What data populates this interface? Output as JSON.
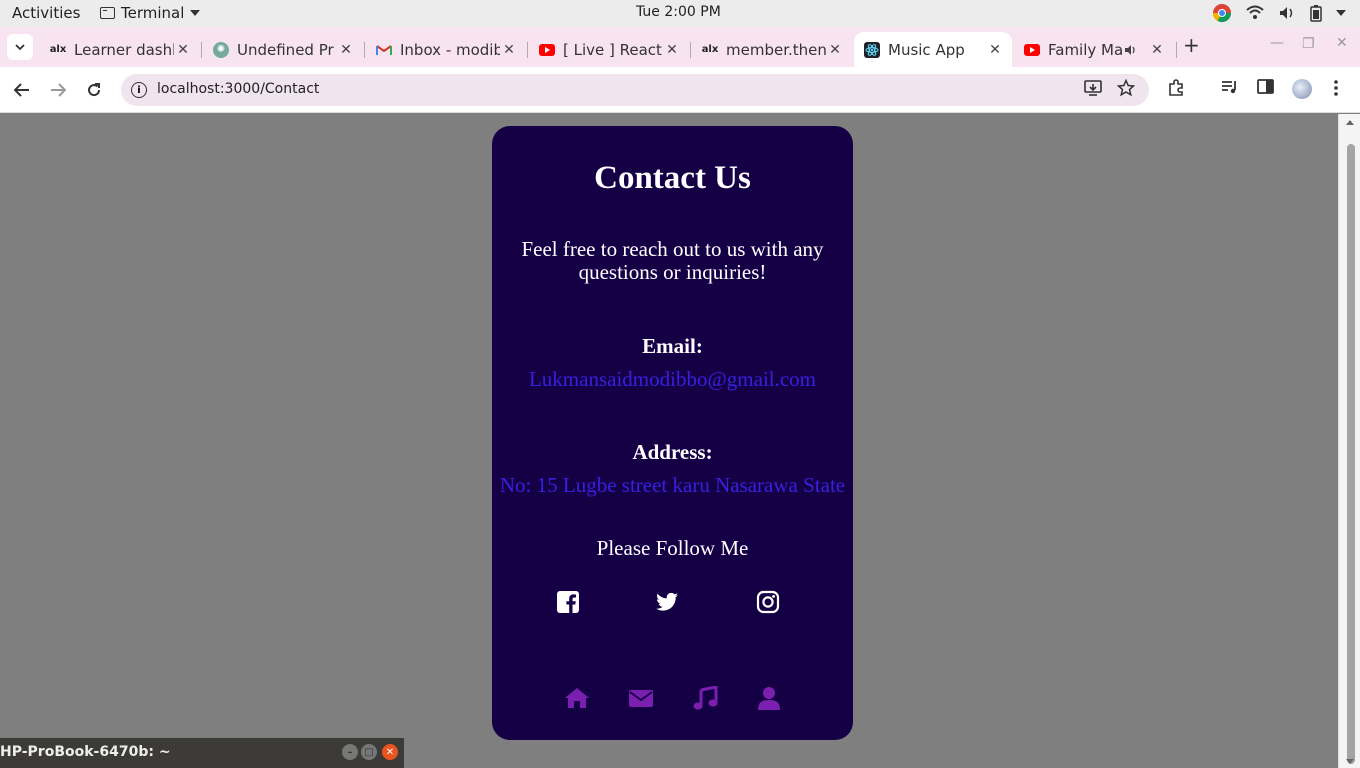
{
  "topbar": {
    "activities": "Activities",
    "app_name": "Terminal",
    "clock": "Tue  2:00 PM"
  },
  "tabs": [
    {
      "title": "Learner dashboard",
      "favicon": "alx"
    },
    {
      "title": "Undefined Pr",
      "favicon": "chatgpt"
    },
    {
      "title": "Inbox - modib",
      "favicon": "gmail"
    },
    {
      "title": "[ Live ] React",
      "favicon": "youtube"
    },
    {
      "title": "member.then",
      "favicon": "alx"
    },
    {
      "title": "Music App",
      "favicon": "react",
      "active": true
    },
    {
      "title": "Family Ma",
      "favicon": "youtube",
      "audio": true
    }
  ],
  "toolbar": {
    "url": "localhost:3000/Contact"
  },
  "contact": {
    "heading": "Contact Us",
    "intro": "Feel free to reach out to us with any questions or inquiries!",
    "email_label": "Email:",
    "email_value": "Lukmansaidmodibbo@gmail.com",
    "address_label": "Address:",
    "address_value": "No: 15 Lugbe street karu Nasarawa State",
    "follow_text": "Please Follow Me",
    "social_icons": [
      "facebook-icon",
      "twitter-icon",
      "instagram-icon"
    ],
    "nav_icons": [
      "home-icon",
      "envelope-icon",
      "music-icon",
      "user-icon"
    ]
  },
  "terminal": {
    "title": "HP-ProBook-6470b: ~"
  },
  "colors": {
    "card_bg": "#150045",
    "link": "#3720e0",
    "nav_icon": "#7a1fb0",
    "page_bg": "#7f7f7f"
  }
}
